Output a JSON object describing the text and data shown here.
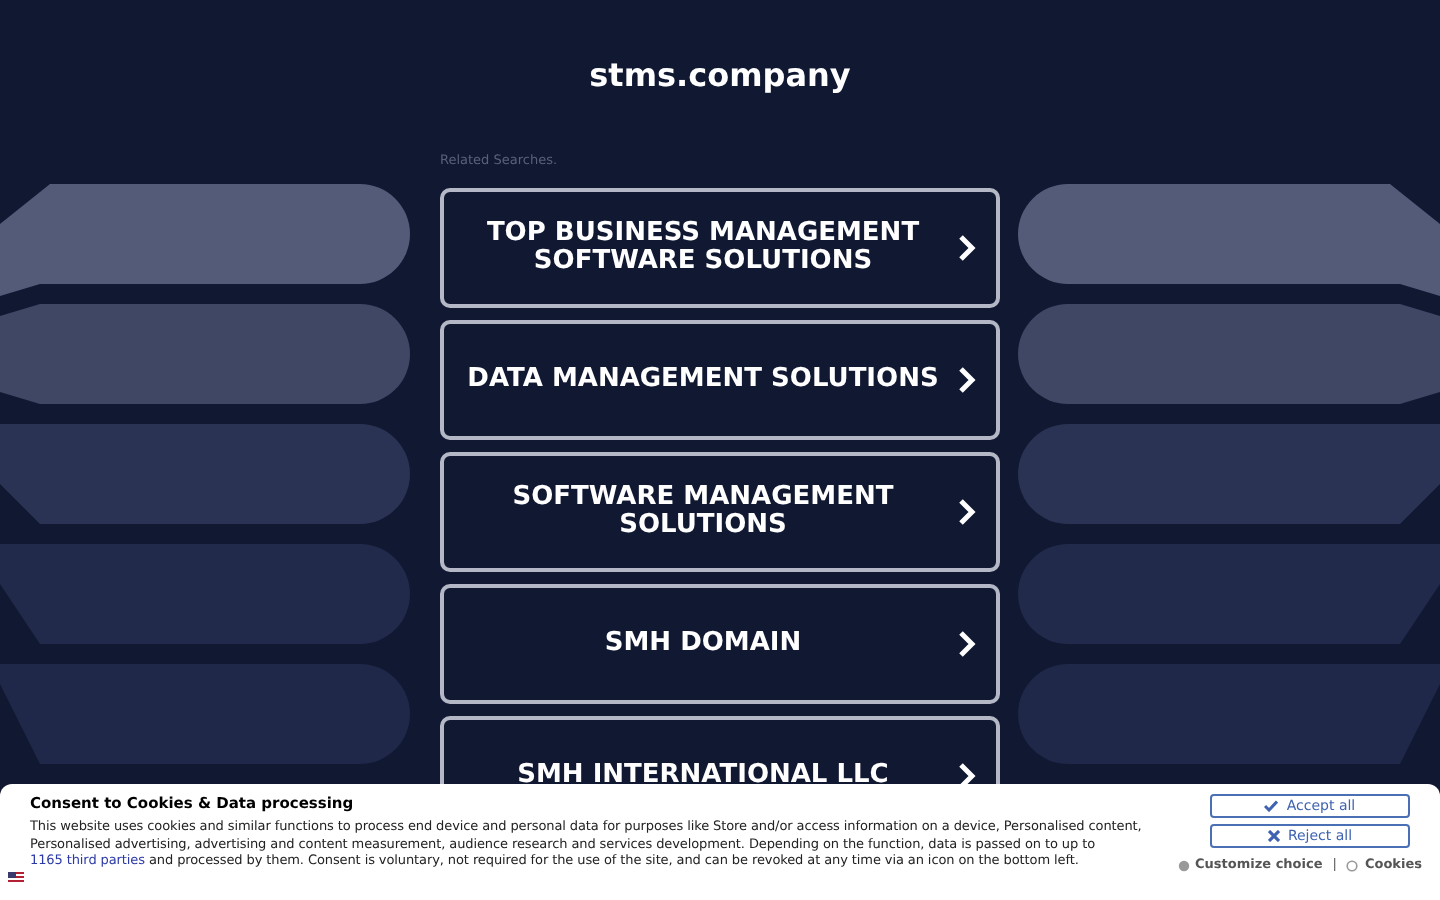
{
  "site_title": "stms.company",
  "related_label": "Related Searches.",
  "links": [
    {
      "label": "TOP BUSINESS MANAGEMENT SOFTWARE SOLUTIONS"
    },
    {
      "label": "DATA MANAGEMENT SOLUTIONS"
    },
    {
      "label": "SOFTWARE MANAGEMENT SOLUTIONS"
    },
    {
      "label": "SMH DOMAIN"
    },
    {
      "label": "SMH INTERNATIONAL LLC"
    }
  ],
  "consent": {
    "title": "Consent to Cookies & Data processing",
    "text_before": "This website uses cookies and similar functions to process end device and personal data for purposes like Store and/or access information on a device, Personalised content, Personalised advertising, advertising and content measurement, audience research and services development. Depending on the function, data is passed on to up to ",
    "link": "1165 third parties",
    "text_after": " and processed by them. Consent is voluntary, not required for the use of the site, and can be revoked at any time via an icon on the bottom left.",
    "accept": "Accept all",
    "reject": "Reject all",
    "customize": "Customize choice",
    "separator": "|",
    "cookies": "Cookies"
  }
}
